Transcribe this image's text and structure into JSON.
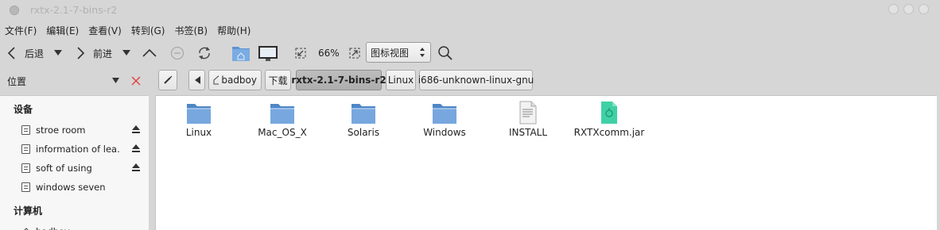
{
  "window": {
    "title": "rxtx-2.1-7-bins-r2"
  },
  "menu": [
    "文件(F)",
    "编辑(E)",
    "查看(V)",
    "转到(G)",
    "书签(B)",
    "帮助(H)"
  ],
  "toolbar": {
    "back_label": "后退",
    "forward_label": "前进",
    "zoom": "66%",
    "view_mode": "图标视图"
  },
  "sidebar": {
    "header": "位置",
    "devices_title": "设备",
    "devices": [
      {
        "label": "stroe room",
        "ejectable": true
      },
      {
        "label": "information of lea...",
        "ejectable": true
      },
      {
        "label": "soft of using",
        "ejectable": true
      },
      {
        "label": "windows seven",
        "ejectable": false
      }
    ],
    "computer_title": "计算机",
    "computer_items": [
      {
        "label": "badboy"
      }
    ]
  },
  "path": [
    "badboy",
    "下载",
    "rxtx-2.1-7-bins-r2",
    "Linux",
    "i686-unknown-linux-gnu"
  ],
  "active_crumb": "rxtx-2.1-7-bins-r2",
  "files": [
    {
      "name": "Linux",
      "kind": "folder-icon"
    },
    {
      "name": "Mac_OS_X",
      "kind": "folder-icon"
    },
    {
      "name": "Solaris",
      "kind": "folder-icon"
    },
    {
      "name": "Windows",
      "kind": "folder-icon"
    },
    {
      "name": "INSTALL",
      "kind": "text-file-icon"
    },
    {
      "name": "RXTXcomm.jar",
      "kind": "jar-file-icon"
    }
  ],
  "colors": {
    "folder": "#6f9fd6",
    "jar": "#3fd1a5",
    "chrome": "#d6d6d6",
    "close_red": "#e04040"
  }
}
